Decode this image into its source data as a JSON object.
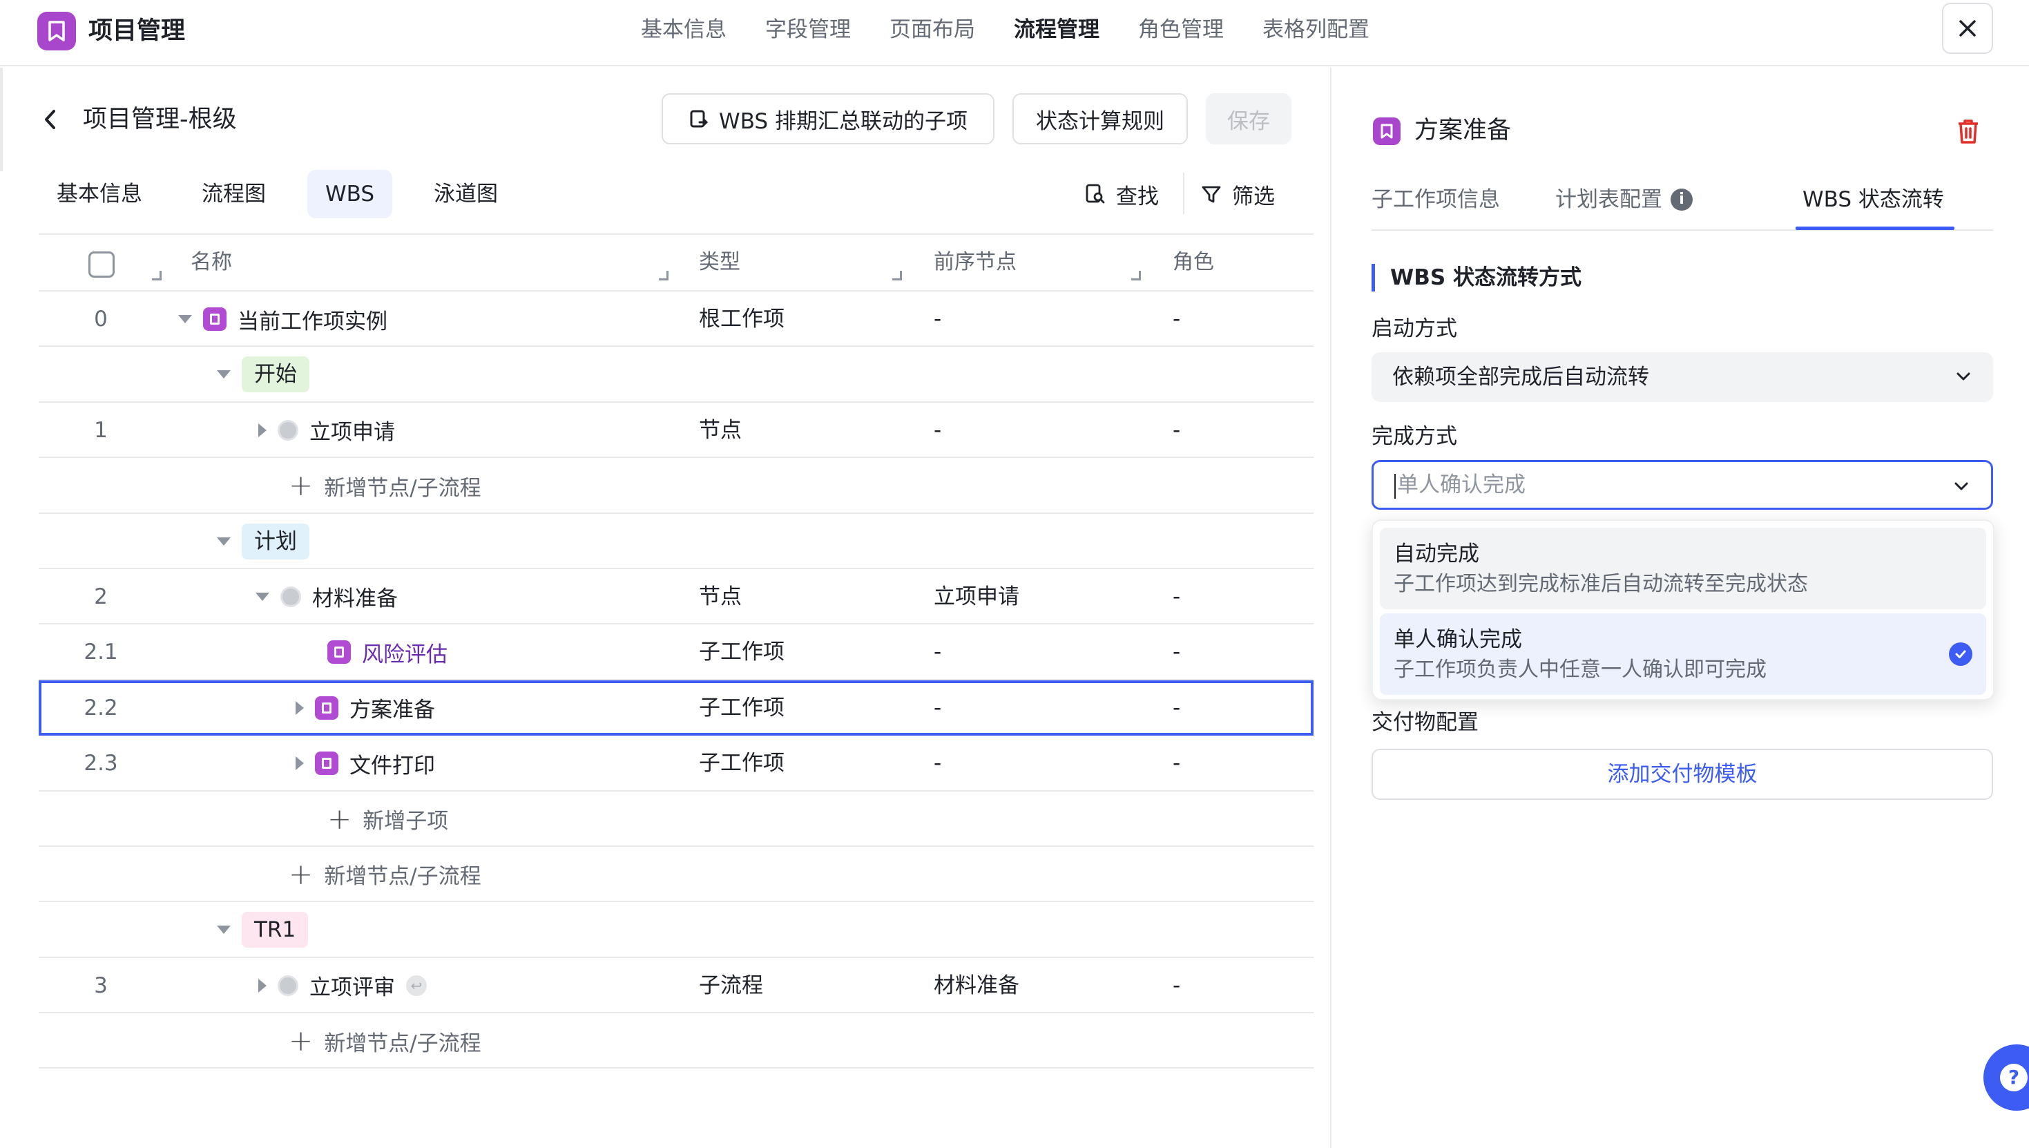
{
  "header": {
    "app_title": "项目管理",
    "tabs": [
      {
        "label": "基本信息"
      },
      {
        "label": "字段管理"
      },
      {
        "label": "页面布局"
      },
      {
        "label": "流程管理",
        "active": true
      },
      {
        "label": "角色管理"
      },
      {
        "label": "表格列配置"
      }
    ],
    "close_icon": "close-icon"
  },
  "left": {
    "title": "项目管理-根级",
    "buttons": {
      "wbs": "WBS 排期汇总联动的子项",
      "rule": "状态计算规则",
      "save": "保存"
    },
    "tabs": [
      {
        "label": "基本信息"
      },
      {
        "label": "流程图"
      },
      {
        "label": "WBS",
        "active": true
      },
      {
        "label": "泳道图"
      }
    ],
    "tools": {
      "find": "查找",
      "filter": "筛选"
    },
    "table": {
      "columns": {
        "name": "名称",
        "type": "类型",
        "pre": "前序节点",
        "role": "角色"
      },
      "rows": {
        "r0": {
          "idx": "0",
          "name": "当前工作项实例",
          "type": "根工作项",
          "pre": "-",
          "role": "-"
        },
        "phase_start": "开始",
        "r1": {
          "idx": "1",
          "name": "立项申请",
          "type": "节点",
          "pre": "-",
          "role": "-"
        },
        "add_node_1": "新增节点/子流程",
        "phase_plan": "计划",
        "r2": {
          "idx": "2",
          "name": "材料准备",
          "type": "节点",
          "pre": "立项申请",
          "role": "-"
        },
        "r21": {
          "idx": "2.1",
          "name": "风险评估",
          "type": "子工作项",
          "pre": "-",
          "role": "-"
        },
        "r22": {
          "idx": "2.2",
          "name": "方案准备",
          "type": "子工作项",
          "pre": "-",
          "role": "-"
        },
        "r23": {
          "idx": "2.3",
          "name": "文件打印",
          "type": "子工作项",
          "pre": "-",
          "role": "-"
        },
        "add_child": "新增子项",
        "add_node_2": "新增节点/子流程",
        "phase_tr1": "TR1",
        "r3": {
          "idx": "3",
          "name": "立项评审",
          "type": "子流程",
          "pre": "材料准备",
          "role": "-"
        },
        "add_node_3": "新增节点/子流程"
      }
    }
  },
  "right": {
    "title": "方案准备",
    "tabs": {
      "sub_info": "子工作项信息",
      "plan": "计划表配置",
      "wbs_flow": "WBS 状态流转"
    },
    "section_title": "WBS 状态流转方式",
    "start_label": "启动方式",
    "start_value": "依赖项全部完成后自动流转",
    "complete_label": "完成方式",
    "complete_placeholder": "单人确认完成",
    "options": {
      "auto": {
        "title": "自动完成",
        "desc": "子工作项达到完成标准后自动流转至完成状态"
      },
      "single": {
        "title": "单人确认完成",
        "desc": "子工作项负责人中任意一人确认即可完成"
      }
    },
    "deliverable_label": "交付物配置",
    "deliverable_button": "添加交付物模板"
  },
  "help": "?",
  "colors": {
    "accent": "#3c5cf4",
    "brand_purple": "#a846cc",
    "danger": "#e22e28"
  }
}
